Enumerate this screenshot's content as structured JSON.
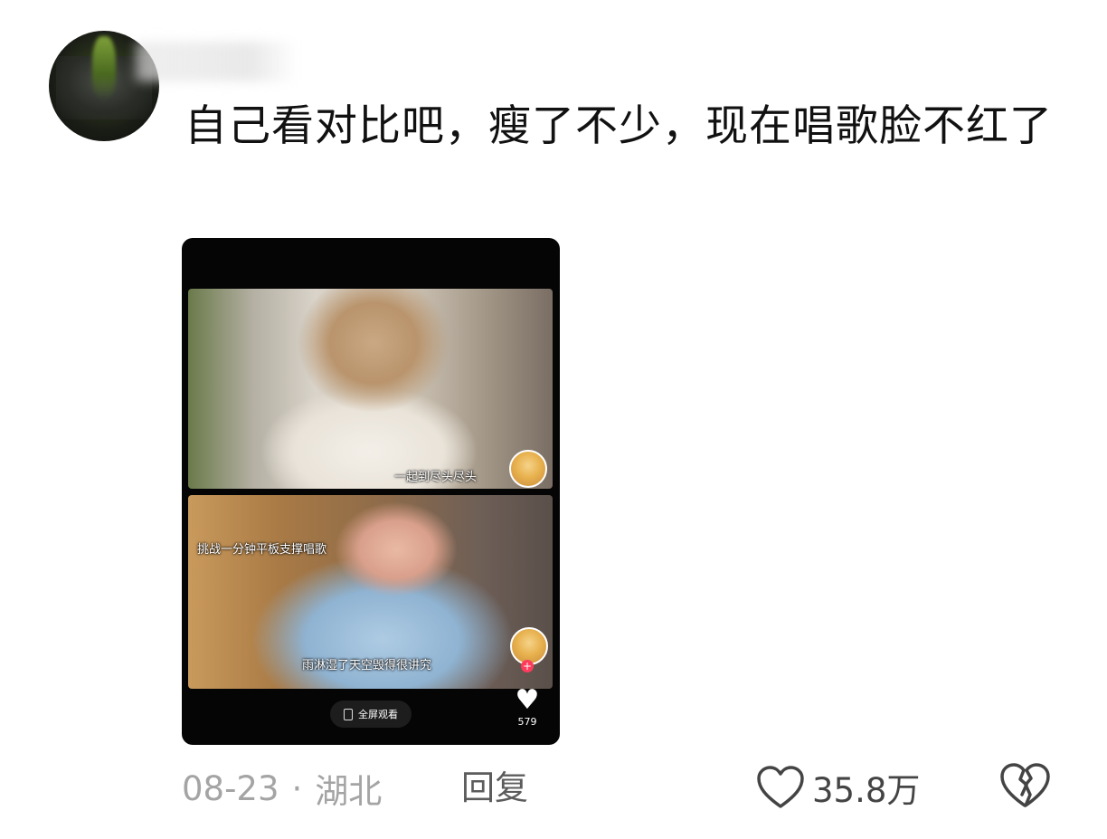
{
  "comment": {
    "text": "自己看对比吧，瘦了不少，现在唱歌脸不红了",
    "date": "08-23",
    "location": "湖北",
    "separator": "·",
    "reply_label": "回复",
    "like_count": "35.8万"
  },
  "media": {
    "top_frame_caption": "一起到尽头尽头",
    "bottom_frame_caption_1": "挑战一分钟平板支撑唱歌",
    "bottom_frame_caption_2": "雨淋湿了天空毁得很讲究",
    "fullscreen_label": "全屏观看",
    "video_like_count": "579"
  },
  "icons": {
    "like": "heart-outline-icon",
    "dislike": "broken-heart-icon",
    "fullscreen": "fullscreen-phone-icon"
  },
  "colors": {
    "text_primary": "#111111",
    "meta_gray": "#a4a4a4",
    "reply_gray": "#5c5c5c",
    "media_bg": "#050505"
  }
}
